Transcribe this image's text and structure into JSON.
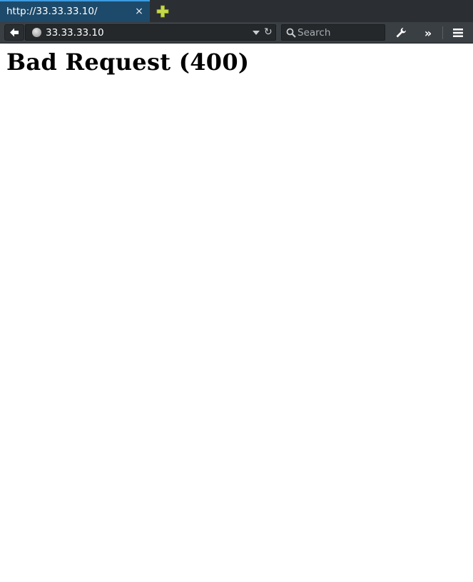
{
  "tab": {
    "title": "http://33.33.33.10/",
    "close_glyph": "×"
  },
  "navbar": {
    "url": "33.33.33.10",
    "reload_glyph": "↻",
    "search_placeholder": "Search",
    "overflow_glyph": "»"
  },
  "icons": {
    "back": "back-arrow-icon",
    "site": "globe-icon",
    "search": "magnifier-icon",
    "tools": "wrench-icon",
    "menu": "hamburger-menu-icon",
    "new_tab": "plus-icon"
  },
  "colors": {
    "tab_active": "#1d4a6a",
    "tab_accent": "#3d9be0",
    "toolbar": "#3a3f44",
    "new_tab_plus": "#c6d94a"
  },
  "page": {
    "heading": "Bad Request (400)"
  }
}
